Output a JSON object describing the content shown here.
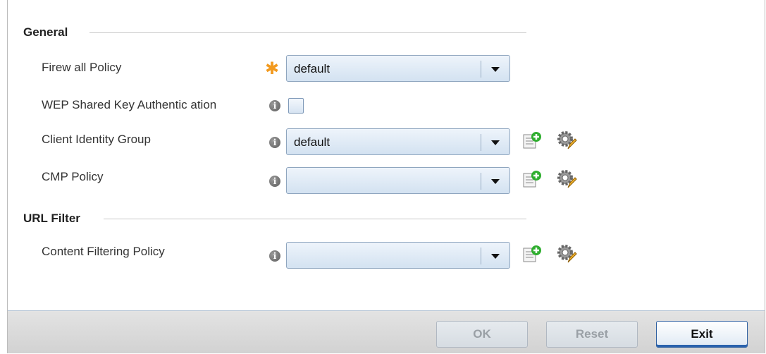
{
  "sections": {
    "general": {
      "title": "General",
      "firewall_policy": {
        "label": "Firew all Policy",
        "value": "default"
      },
      "wep_shared_key": {
        "label": "WEP Shared Key Authentic ation",
        "checked": false
      },
      "client_identity_group": {
        "label": "Client Identity Group",
        "value": "default"
      },
      "cmp_policy": {
        "label": "CMP Policy",
        "value": ""
      }
    },
    "url_filter": {
      "title": "URL Filter",
      "content_filtering_policy": {
        "label": "Content Filtering Policy",
        "value": ""
      }
    }
  },
  "buttons": {
    "ok": "OK",
    "reset": "Reset",
    "exit": "Exit"
  },
  "colors": {
    "required_star": "#f29a1f",
    "primary_button_border": "#2c5ea0"
  },
  "icons": {
    "required": "star-icon",
    "info": "info-icon",
    "add": "add-policy-icon",
    "edit": "gear-edit-icon"
  }
}
